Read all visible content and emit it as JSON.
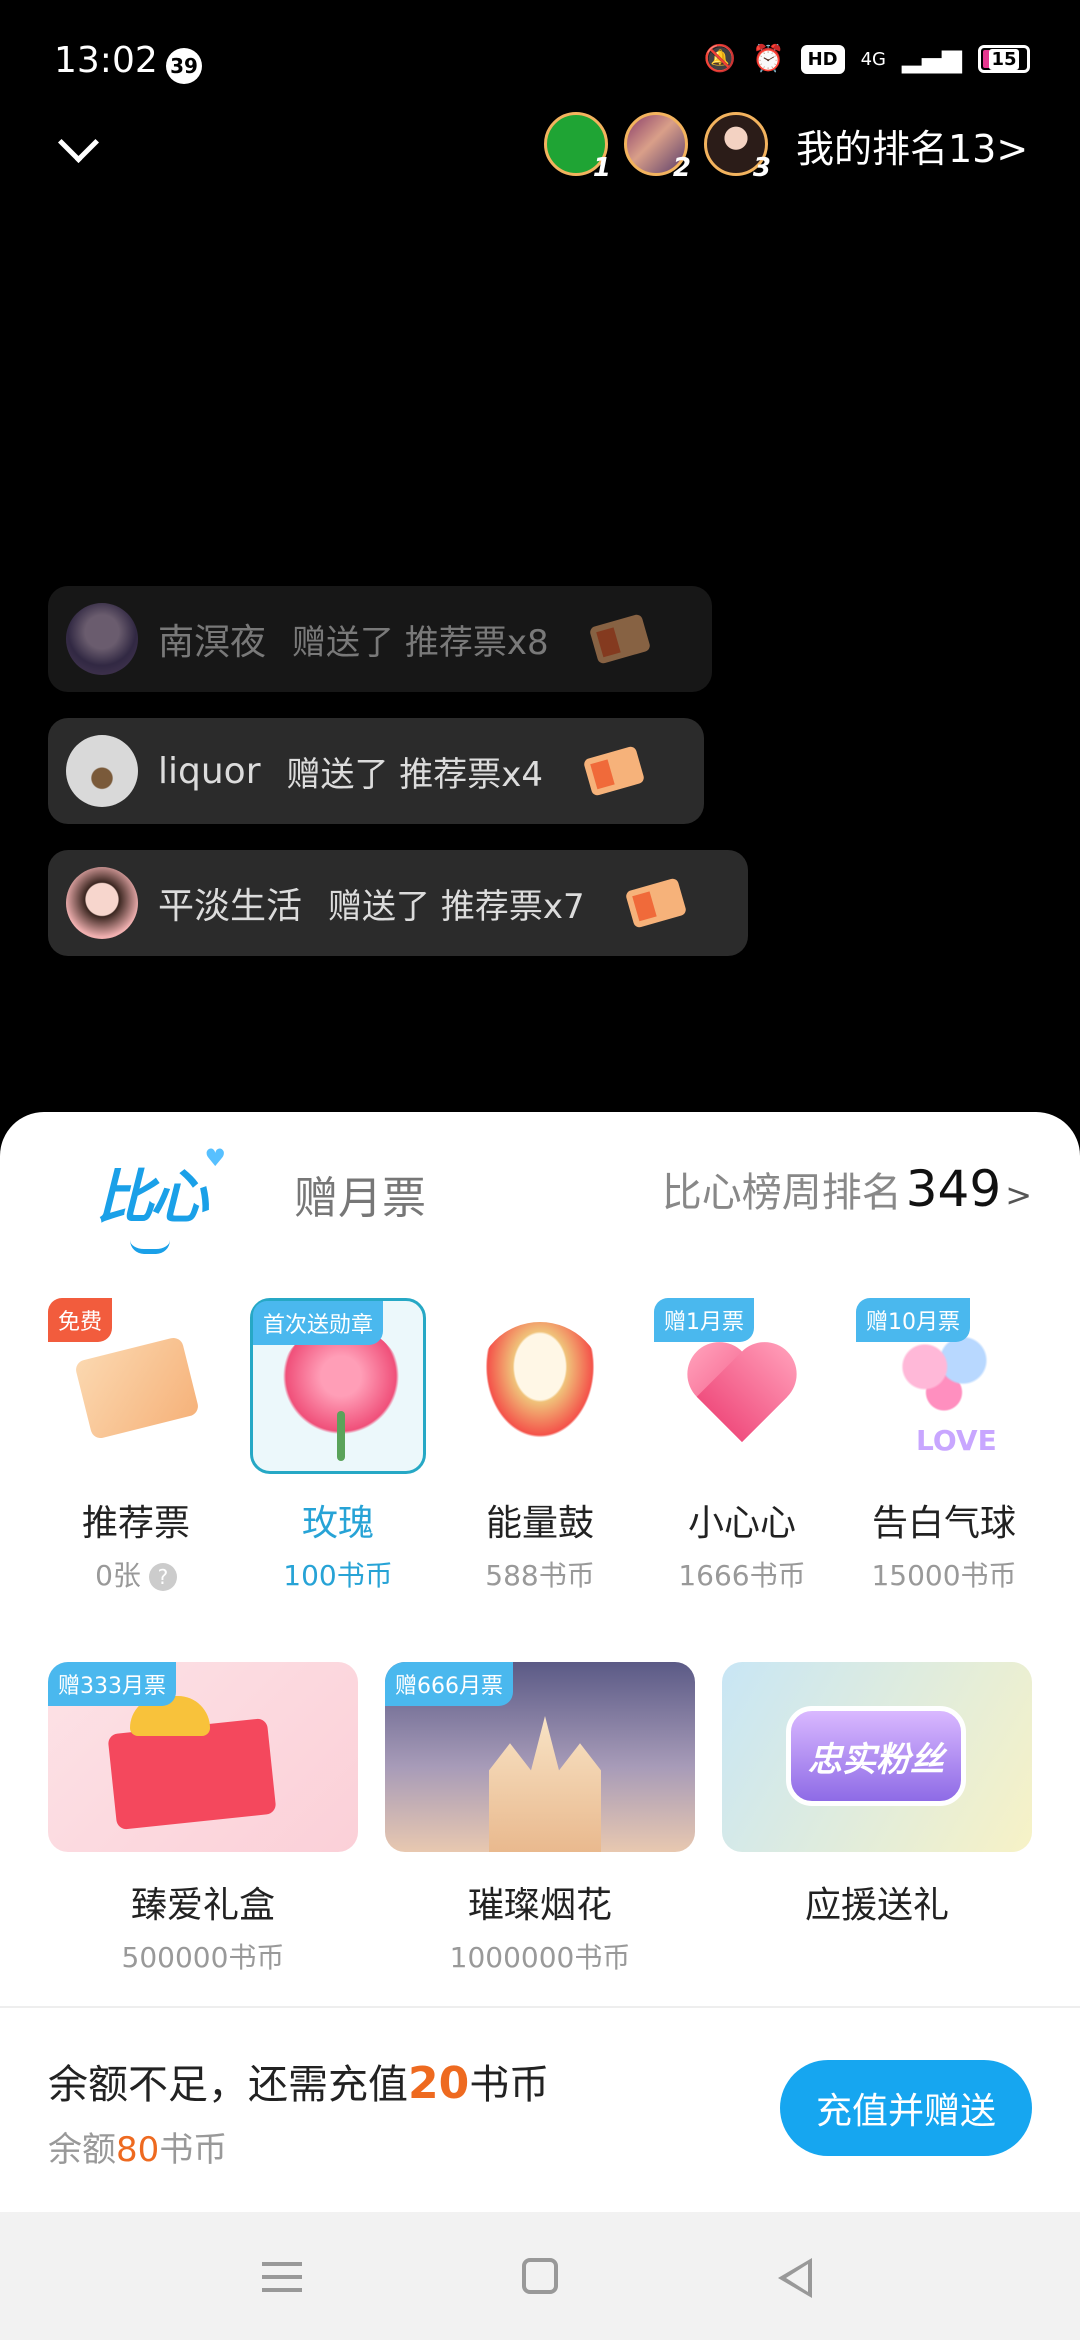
{
  "status_bar": {
    "time": "13:02",
    "notification_count": "39",
    "hd_label": "HD",
    "network": "4G",
    "battery": "15"
  },
  "top_bar": {
    "rank_numbers": [
      "1",
      "2",
      "3"
    ],
    "my_rank": "我的排名13>"
  },
  "gift_notices": [
    {
      "user": "南溟夜",
      "text": "赠送了 推荐票x8"
    },
    {
      "user": "liquor",
      "text": "赠送了 推荐票x4"
    },
    {
      "user": "平淡生活",
      "text": "赠送了 推荐票x7"
    }
  ],
  "sheet": {
    "tab_bixin": "比心",
    "tab_yuepiao": "赠月票",
    "week_rank_label": "比心榜周排名",
    "week_rank_value": "349",
    "week_rank_arrow": ">",
    "gifts_row1": [
      {
        "tag": "免费",
        "name": "推荐票",
        "price": "0张"
      },
      {
        "tag": "首次送勋章",
        "name": "玫瑰",
        "price": "100书币"
      },
      {
        "tag": "",
        "name": "能量鼓",
        "price": "588书币"
      },
      {
        "tag": "赠1月票",
        "name": "小心心",
        "price": "1666书币"
      },
      {
        "tag": "赠10月票",
        "name": "告白气球",
        "price": "15000书币"
      }
    ],
    "help_icon": "?",
    "love_text": "LOVE",
    "gifts_row2": [
      {
        "tag": "赠333月票",
        "name": "臻爱礼盒",
        "price": "500000书币"
      },
      {
        "tag": "赠666月票",
        "name": "璀璨烟花",
        "price": "1000000书币"
      },
      {
        "tag": "",
        "name": "应援送礼",
        "price": "",
        "badge": "忠实粉丝"
      }
    ],
    "balance": {
      "prefix": "余额不足，还需充值",
      "amount": "20",
      "suffix": "书币",
      "sub_prefix": "余额",
      "sub_amount": "80",
      "sub_suffix": "书币"
    },
    "recharge_button": "充值并赠送"
  },
  "colors": {
    "accent_blue": "#16a6f0",
    "highlight_orange": "#ee6a20",
    "selected_border": "#26a8c5"
  }
}
